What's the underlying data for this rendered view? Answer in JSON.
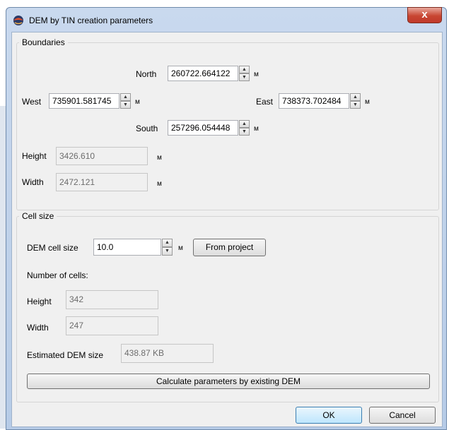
{
  "window": {
    "title": "DEM by TIN creation parameters",
    "close": "x",
    "icon": "app-globe-icon"
  },
  "boundaries": {
    "label": "Boundaries",
    "north": {
      "label": "North",
      "value": "260722.664122",
      "unit": "м"
    },
    "west": {
      "label": "West",
      "value": "735901.581745",
      "unit": "м"
    },
    "east": {
      "label": "East",
      "value": "738373.702484",
      "unit": "м"
    },
    "south": {
      "label": "South",
      "value": "257296.054448",
      "unit": "м"
    },
    "height": {
      "label": "Height",
      "value": "3426.610",
      "unit": "м"
    },
    "width": {
      "label": "Width",
      "value": "2472.121",
      "unit": "м"
    }
  },
  "cell_size": {
    "label": "Cell size",
    "dem_cell_size": {
      "label": "DEM cell size",
      "value": "10.0",
      "unit": "м"
    },
    "from_project": "From project",
    "number_of_cells": "Number of cells:",
    "height": {
      "label": "Height",
      "value": "342"
    },
    "width": {
      "label": "Width",
      "value": "247"
    },
    "estimated": {
      "label": "Estimated DEM size",
      "value": "438.87 KB"
    },
    "calculate": "Calculate parameters by existing DEM"
  },
  "buttons": {
    "ok": "OK",
    "cancel": "Cancel"
  }
}
